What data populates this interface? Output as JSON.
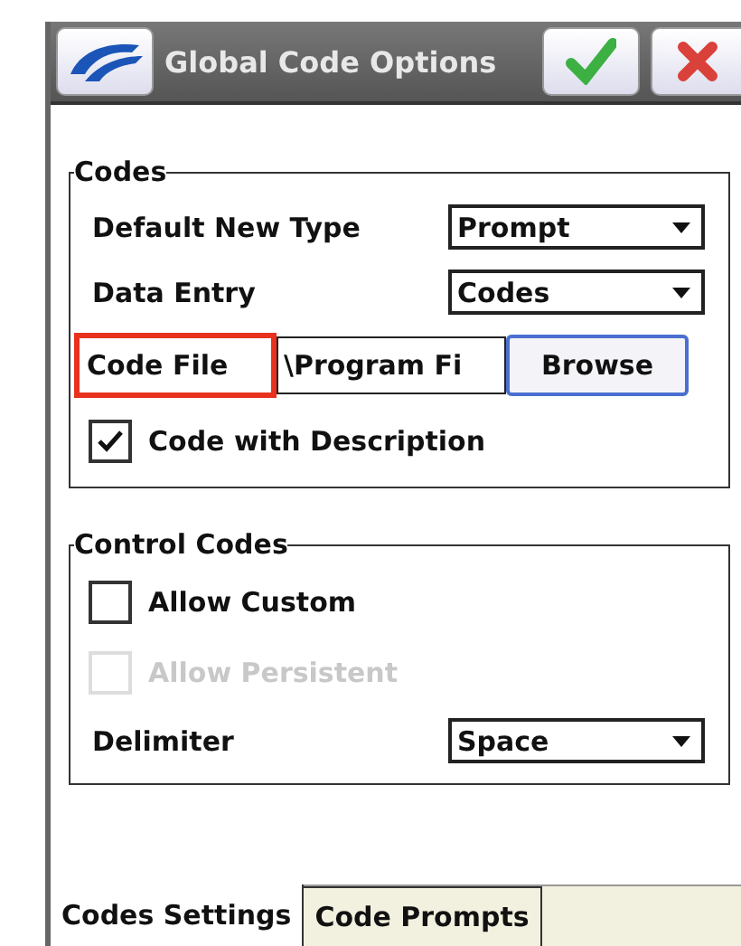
{
  "window": {
    "title": "Global Code Options"
  },
  "groups": [
    {
      "title": "Codes",
      "rows": [
        {
          "kind": "select",
          "label": "Default New Type",
          "value": "Prompt"
        },
        {
          "kind": "select",
          "label": "Data Entry",
          "value": "Codes"
        },
        {
          "kind": "file",
          "label": "Code File",
          "highlighted": true,
          "value": "\\Program Fi",
          "button": "Browse"
        },
        {
          "kind": "checkbox",
          "label": "Code with Description",
          "checked": true,
          "disabled": false
        }
      ]
    },
    {
      "title": "Control Codes",
      "rows": [
        {
          "kind": "checkbox",
          "label": "Allow Custom",
          "checked": false,
          "disabled": false
        },
        {
          "kind": "checkbox",
          "label": "Allow Persistent",
          "checked": false,
          "disabled": true
        },
        {
          "kind": "select",
          "label": "Delimiter",
          "value": "Space"
        }
      ]
    }
  ],
  "tabs": [
    {
      "label": "Codes Settings",
      "selected": true
    },
    {
      "label": "Code Prompts",
      "selected": false
    }
  ]
}
